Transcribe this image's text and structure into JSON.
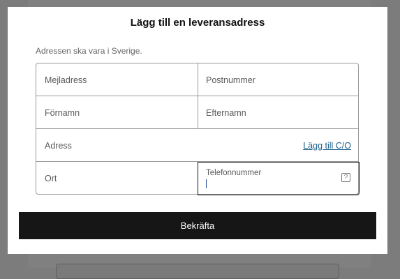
{
  "modal": {
    "title": "Lägg till en leveransadress",
    "hint": "Adressen ska vara i Sverige."
  },
  "form": {
    "email_placeholder": "Mejladress",
    "postal_code_placeholder": "Postnummer",
    "first_name_placeholder": "Förnamn",
    "last_name_placeholder": "Efternamn",
    "address_placeholder": "Adress",
    "add_co_link": "Lägg till C/O",
    "city_placeholder": "Ort",
    "phone_label": "Telefonnummer",
    "phone_value": "",
    "help_icon": "question-mark-icon"
  },
  "actions": {
    "confirm_label": "Bekräfta"
  }
}
